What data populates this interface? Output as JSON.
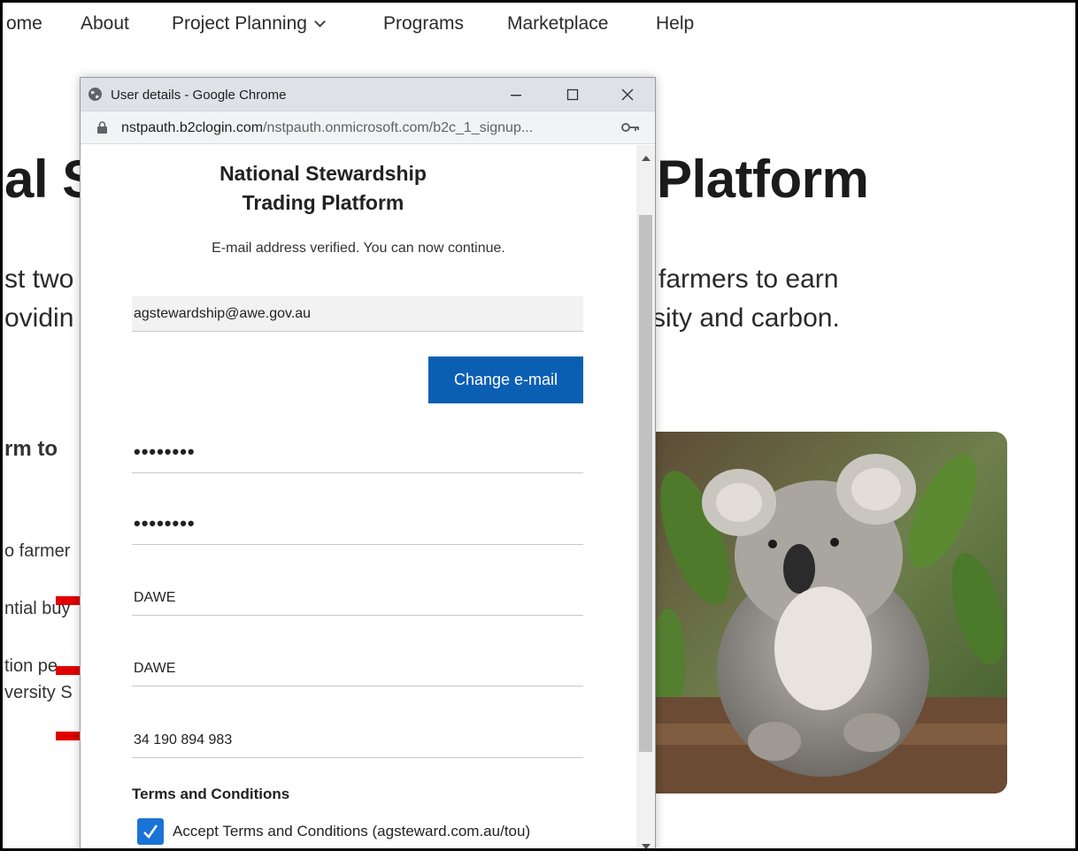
{
  "nav": {
    "items": [
      "ome",
      "About",
      "Project Planning",
      "Programs",
      "Marketplace",
      "Help"
    ]
  },
  "hero": {
    "title_left": "al S",
    "title_right": "Platform",
    "line1_left": "st two",
    "line1_right": "farmers to earn",
    "line2_left": "ovidin",
    "line2_right": "rsity and carbon."
  },
  "side": {
    "heading": "rm to",
    "line1": "o farmer",
    "line2": "ntial buy",
    "line3": "tion pe",
    "line4": "versity S"
  },
  "popup": {
    "window_title": "User details - Google Chrome",
    "url_host": "nstpauth.b2clogin.com",
    "url_path": "/nstpauth.onmicrosoft.com/b2c_1_signup...",
    "brand_line1": "National Stewardship",
    "brand_line2": "Trading Platform",
    "verified_msg": "E-mail address verified. You can now continue.",
    "email": "agstewardship@awe.gov.au",
    "change_email_label": "Change e-mail",
    "password": "••••••••",
    "confirm_password": "••••••••",
    "field1": "DAWE",
    "field2": "DAWE",
    "field3": "34 190 894 983",
    "terms_heading": "Terms and Conditions",
    "terms_label": "Accept Terms and Conditions (agsteward.com.au/tou)"
  },
  "colors": {
    "button": "#0b5fb3",
    "checkbox": "#1a73d6",
    "arrow": "#e00000"
  },
  "icons": [
    "globe-icon",
    "minimize-icon",
    "maximize-icon",
    "close-icon",
    "lock-icon",
    "key-icon",
    "chevron-down-icon",
    "checkmark-icon",
    "red-arrow-icon"
  ]
}
